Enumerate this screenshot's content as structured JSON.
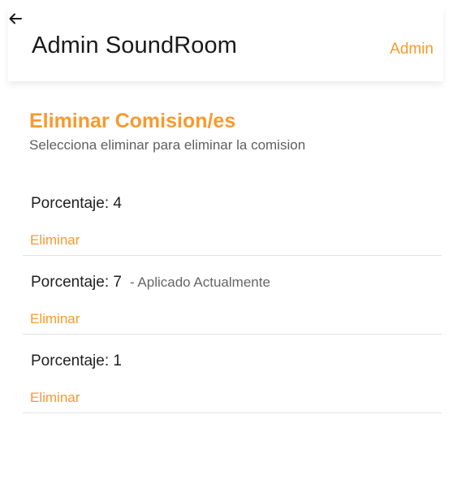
{
  "header": {
    "back_icon": "arrow-left-icon",
    "title": "Admin SoundRoom",
    "user_label": "Admin"
  },
  "section": {
    "title": "Eliminar Comision/es",
    "subtitle": "Selecciona eliminar para eliminar la comision"
  },
  "commissions": [
    {
      "label": "Porcentaje: 4",
      "note": "",
      "action": "Eliminar"
    },
    {
      "label": "Porcentaje: 7",
      "note": "- Aplicado Actualmente",
      "action": "Eliminar"
    },
    {
      "label": "Porcentaje: 1",
      "note": "",
      "action": "Eliminar"
    }
  ],
  "colors": {
    "accent": "#f79a2e",
    "text": "#1f1f1f",
    "muted": "#606060",
    "divider": "#e2e2e2"
  }
}
